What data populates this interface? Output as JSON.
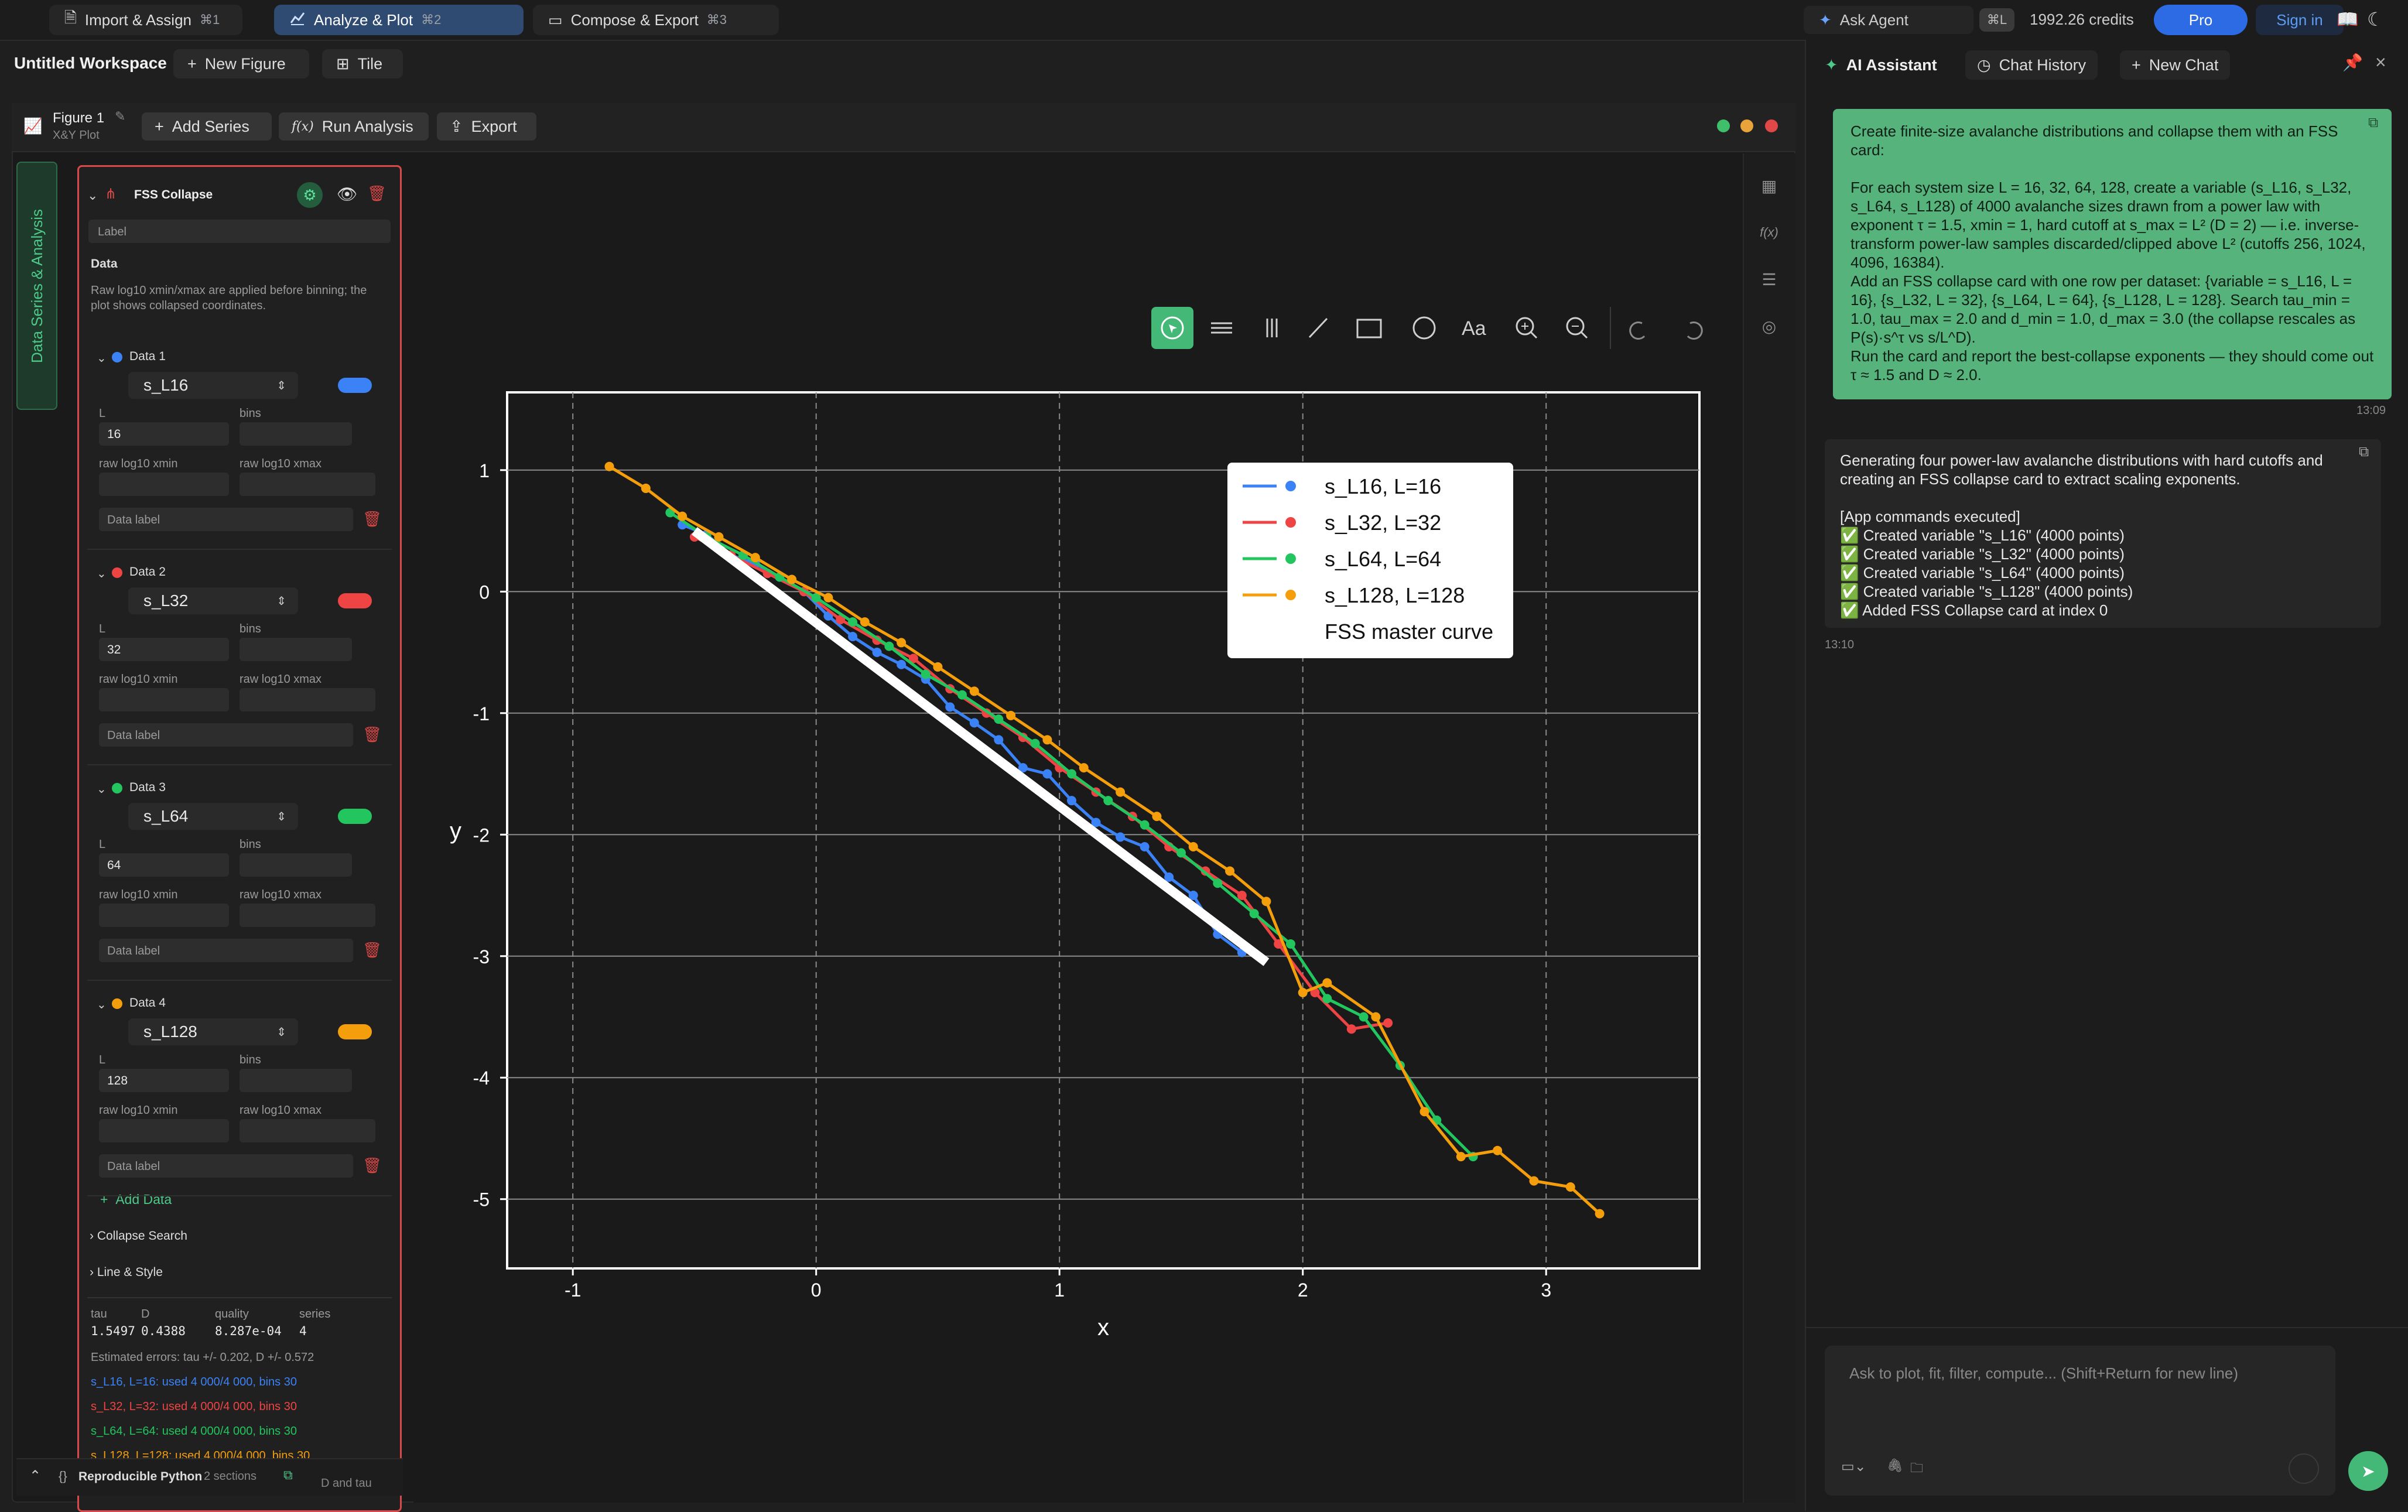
{
  "topbar": {
    "tabs": [
      {
        "label": "Import & Assign",
        "shortcut": "⌘1",
        "icon": "document-icon"
      },
      {
        "label": "Analyze & Plot",
        "shortcut": "⌘2",
        "icon": "chart-icon"
      },
      {
        "label": "Compose & Export",
        "shortcut": "⌘3",
        "icon": "layout-icon"
      }
    ],
    "ask_agent": "Ask Agent",
    "ask_agent_kbd": "⌘L",
    "credits": "1992.26 credits",
    "pro": "Pro",
    "sign_in": "Sign in"
  },
  "workspace": {
    "title": "Untitled Workspace",
    "new_figure": "New Figure",
    "tile": "Tile"
  },
  "figure": {
    "name": "Figure 1",
    "type": "X&Y Plot",
    "add_series": "Add Series",
    "run_analysis": "Run Analysis",
    "run_analysis_icon": "f(x)",
    "export": "Export",
    "side_tab": "Data Series & Analysis"
  },
  "card": {
    "title": "FSS Collapse",
    "label_placeholder": "Label",
    "data_heading": "Data",
    "note": "Raw log10 xmin/xmax are applied before binning; the plot shows collapsed coordinates.",
    "datasets": [
      {
        "title": "Data 1",
        "variable": "s_L16",
        "L": "16",
        "color": "#3b82f6"
      },
      {
        "title": "Data 2",
        "variable": "s_L32",
        "L": "32",
        "color": "#ef4444"
      },
      {
        "title": "Data 3",
        "variable": "s_L64",
        "L": "64",
        "color": "#22c55e"
      },
      {
        "title": "Data 4",
        "variable": "s_L128",
        "L": "128",
        "color": "#f59e0b"
      }
    ],
    "field_labels": {
      "L": "L",
      "bins": "bins",
      "xmin": "raw log10 xmin",
      "xmax": "raw log10 xmax",
      "data_label": "Data label"
    },
    "add_data": "Add Data",
    "collapse_search": "Collapse Search",
    "line_style": "Line & Style",
    "results": {
      "headers": [
        "tau",
        "D",
        "quality",
        "series"
      ],
      "values": [
        "1.5497",
        "0.4388",
        "8.287e-04",
        "4"
      ],
      "errors": "Estimated errors: tau +/- 0.202, D +/- 0.572",
      "lines": [
        {
          "text": "s_L16, L=16: used 4 000/4 000, bins 30",
          "color": "#3b82f6"
        },
        {
          "text": "s_L32, L=32: used 4 000/4 000, bins 30",
          "color": "#ef4444"
        },
        {
          "text": "s_L64, L=64: used 4 000/4 000, bins 30",
          "color": "#22c55e"
        },
        {
          "text": "s_L128, L=128: used 4 000/4 000, bins 30",
          "color": "#f59e0b"
        }
      ]
    },
    "reproducible": "Reproducible Python",
    "sections": "2 sections",
    "trailing": "D and tau"
  },
  "chart_data": {
    "type": "line",
    "xlabel": "x",
    "ylabel": "y",
    "xlim": [
      -1.27,
      3.63
    ],
    "ylim": [
      -5.57,
      1.64
    ],
    "xticks": [
      -1,
      0,
      1,
      2,
      3
    ],
    "yticks": [
      1,
      0,
      -1,
      -2,
      -3,
      -4,
      -5
    ],
    "grid": true,
    "legend_position": "top-right",
    "series": [
      {
        "name": "s_L16, L=16",
        "color": "#3b82f6",
        "x": [
          -0.55,
          -0.45,
          -0.35,
          -0.25,
          -0.15,
          -0.05,
          0.05,
          0.15,
          0.25,
          0.35,
          0.45,
          0.55,
          0.65,
          0.75,
          0.85,
          0.95,
          1.05,
          1.15,
          1.25,
          1.35,
          1.45,
          1.55,
          1.65,
          1.75
        ],
        "y": [
          0.55,
          0.47,
          0.3,
          0.23,
          0.12,
          0.0,
          -0.2,
          -0.37,
          -0.5,
          -0.6,
          -0.72,
          -0.95,
          -1.08,
          -1.22,
          -1.45,
          -1.5,
          -1.72,
          -1.9,
          -2.02,
          -2.1,
          -2.35,
          -2.5,
          -2.82,
          -2.97
        ]
      },
      {
        "name": "s_L32, L=32",
        "color": "#ef4444",
        "x": [
          -0.5,
          -0.35,
          -0.2,
          -0.05,
          0.1,
          0.25,
          0.4,
          0.55,
          0.7,
          0.85,
          1.0,
          1.15,
          1.3,
          1.45,
          1.6,
          1.75,
          1.9,
          2.05,
          2.2,
          2.35
        ],
        "y": [
          0.45,
          0.3,
          0.15,
          0.0,
          -0.23,
          -0.4,
          -0.55,
          -0.8,
          -1.0,
          -1.2,
          -1.45,
          -1.65,
          -1.85,
          -2.1,
          -2.3,
          -2.5,
          -2.9,
          -3.3,
          -3.6,
          -3.55
        ]
      },
      {
        "name": "s_L64, L=64",
        "color": "#22c55e",
        "x": [
          -0.6,
          -0.45,
          -0.3,
          -0.15,
          0.0,
          0.15,
          0.3,
          0.45,
          0.6,
          0.75,
          0.9,
          1.05,
          1.2,
          1.35,
          1.5,
          1.65,
          1.8,
          1.95,
          2.1,
          2.25,
          2.4,
          2.55,
          2.7
        ],
        "y": [
          0.65,
          0.45,
          0.3,
          0.12,
          -0.05,
          -0.25,
          -0.45,
          -0.68,
          -0.85,
          -1.05,
          -1.25,
          -1.5,
          -1.72,
          -1.92,
          -2.15,
          -2.4,
          -2.65,
          -2.9,
          -3.35,
          -3.5,
          -3.9,
          -4.35,
          -4.65
        ]
      },
      {
        "name": "s_L128, L=128",
        "color": "#f59e0b",
        "x": [
          -0.85,
          -0.7,
          -0.55,
          -0.4,
          -0.25,
          -0.1,
          0.05,
          0.2,
          0.35,
          0.5,
          0.65,
          0.8,
          0.95,
          1.1,
          1.25,
          1.4,
          1.55,
          1.7,
          1.85,
          2.0,
          2.1,
          2.3,
          2.5,
          2.65,
          2.8,
          2.95,
          3.1,
          3.22
        ],
        "y": [
          1.03,
          0.85,
          0.62,
          0.45,
          0.28,
          0.1,
          -0.05,
          -0.25,
          -0.42,
          -0.62,
          -0.82,
          -1.02,
          -1.22,
          -1.45,
          -1.65,
          -1.85,
          -2.1,
          -2.3,
          -2.55,
          -3.3,
          -3.22,
          -3.5,
          -4.28,
          -4.65,
          -4.6,
          -4.85,
          -4.9,
          -5.12
        ]
      },
      {
        "name": "FSS master curve",
        "color": "#ffffff",
        "x": [
          -0.5,
          1.85
        ],
        "y": [
          0.5,
          -3.05
        ]
      }
    ]
  },
  "plot_toolbar": [
    "pointer-icon",
    "hlines-icon",
    "vlines-icon",
    "line-icon",
    "rect-icon",
    "circle-icon",
    "text-icon",
    "zoom-in-icon",
    "zoom-out-icon",
    "undo-icon",
    "redo-icon"
  ],
  "text_tool_label": "Aa",
  "chat": {
    "title": "AI Assistant",
    "history": "Chat History",
    "new_chat": "New Chat",
    "user_message": "Create finite-size avalanche distributions and collapse them with an FSS card:\n\nFor each system size L = 16, 32, 64, 128, create a variable (s_L16, s_L32, s_L64, s_L128) of 4000 avalanche sizes drawn from a power law with exponent τ = 1.5, xmin = 1, hard cutoff at s_max = L² (D = 2) — i.e. inverse-transform power-law samples discarded/clipped above L² (cutoffs 256, 1024, 4096, 16384).\nAdd an FSS collapse card with one row per dataset: {variable = s_L16, L = 16}, {s_L32, L = 32}, {s_L64, L = 64}, {s_L128, L = 128}. Search tau_min = 1.0, tau_max = 2.0 and d_min = 1.0, d_max = 3.0 (the collapse rescales as P(s)·s^τ vs s/L^D).\nRun the card and report the best-collapse exponents — they should come out τ ≈ 1.5 and D ≈ 2.0.",
    "user_time": "13:09",
    "assistant_message": "Generating four power-law avalanche distributions with hard cutoffs and creating an FSS collapse card to extract scaling exponents.\n\n[App commands executed]\n✅ Created variable \"s_L16\" (4000 points)\n✅ Created variable \"s_L32\" (4000 points)\n✅ Created variable \"s_L64\" (4000 points)\n✅ Created variable \"s_L128\" (4000 points)\n✅ Added FSS Collapse card at index 0",
    "assistant_time": "13:10",
    "input_placeholder": "Ask to plot, fit, filter, compute... (Shift+Return for new line)"
  }
}
